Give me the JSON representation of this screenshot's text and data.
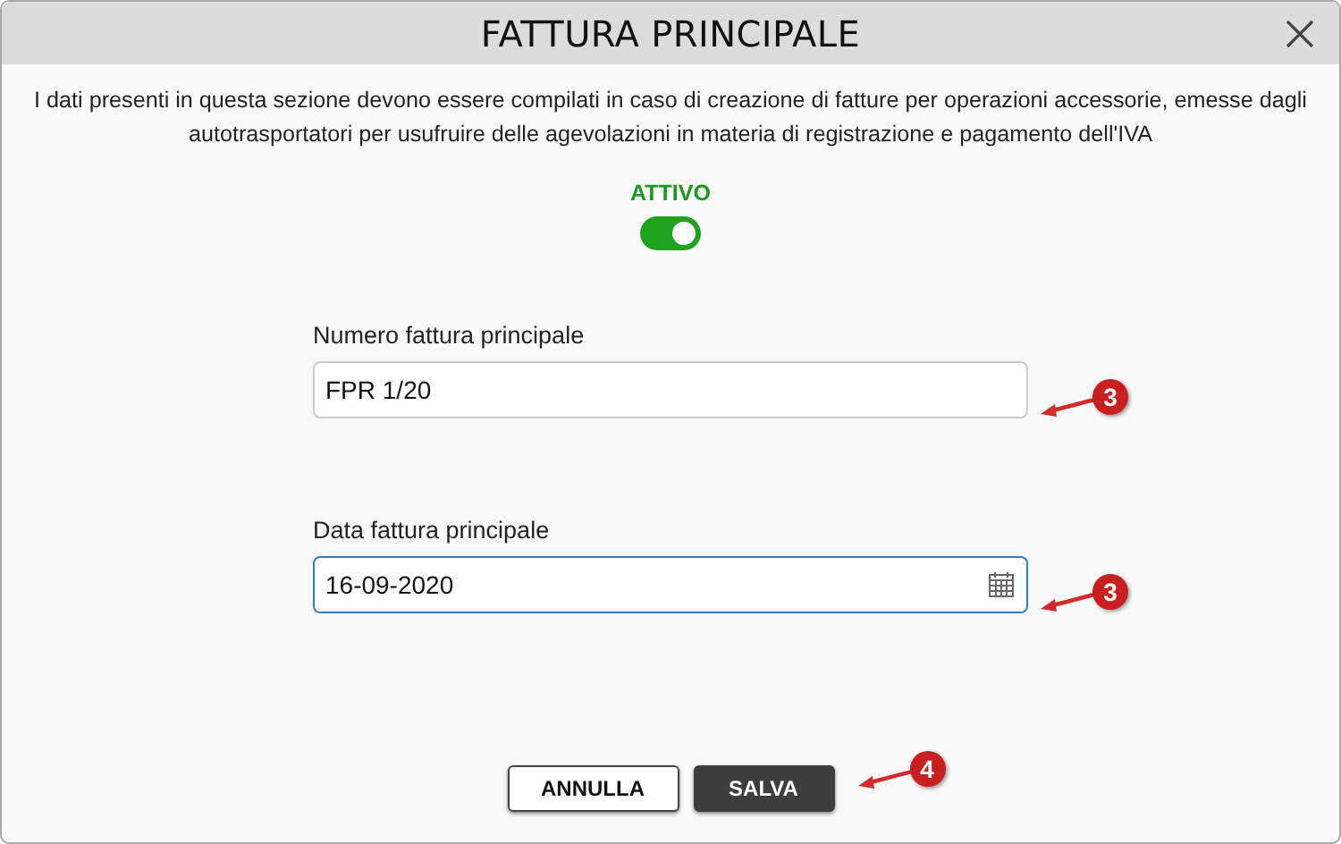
{
  "window": {
    "title": "FATTURA PRINCIPALE"
  },
  "description": "I dati presenti in questa sezione devono essere compilati in caso di creazione di fatture per operazioni accessorie, emesse dagli autotrasportatori per usufruire delle agevolazioni in materia di registrazione e pagamento dell'IVA",
  "toggle": {
    "label": "ATTIVO",
    "on": true
  },
  "fields": [
    {
      "label": "Numero fattura principale",
      "value": "FPR 1/20",
      "kind": "text",
      "focused": false,
      "callout": "3"
    },
    {
      "label": "Data fattura principale",
      "value": "16-09-2020",
      "kind": "date",
      "focused": true,
      "callout": "3"
    }
  ],
  "buttons": [
    {
      "label": "ANNULLA",
      "kind": "secondary"
    },
    {
      "label": "SALVA",
      "kind": "primary",
      "callout": "4"
    }
  ]
}
